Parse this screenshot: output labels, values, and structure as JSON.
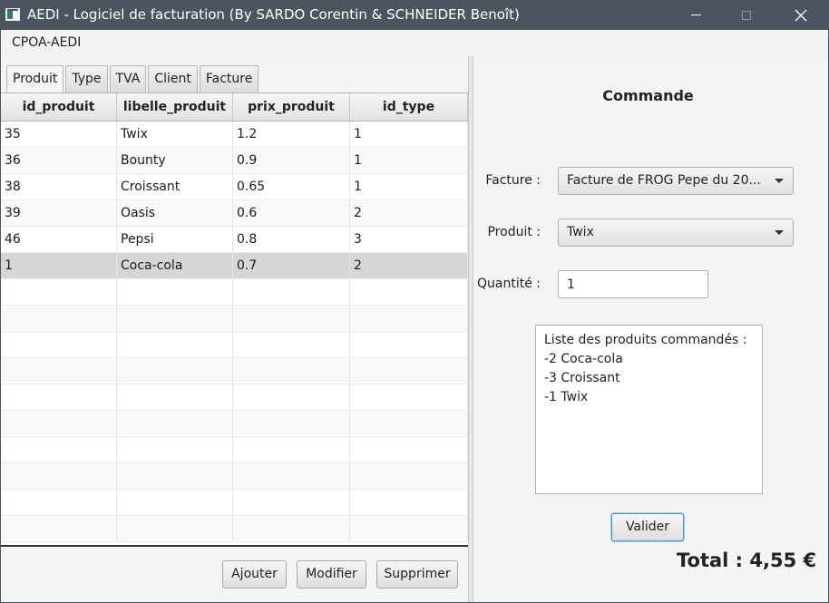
{
  "window": {
    "title": "AEDI - Logiciel de facturation (By SARDO Corentin & SCHNEIDER Benoît)"
  },
  "menu": {
    "items": [
      "CPOA-AEDI"
    ]
  },
  "tabs": [
    {
      "label": "Produit",
      "active": true
    },
    {
      "label": "Type",
      "active": false
    },
    {
      "label": "TVA",
      "active": false
    },
    {
      "label": "Client",
      "active": false
    },
    {
      "label": "Facture",
      "active": false
    }
  ],
  "table": {
    "columns": [
      "id_produit",
      "libelle_produit",
      "prix_produit",
      "id_type"
    ],
    "rows": [
      {
        "cells": [
          "35",
          "Twix",
          "1.2",
          "1"
        ],
        "selected": false
      },
      {
        "cells": [
          "36",
          "Bounty",
          "0.9",
          "1"
        ],
        "selected": false
      },
      {
        "cells": [
          "38",
          "Croissant",
          "0.65",
          "1"
        ],
        "selected": false
      },
      {
        "cells": [
          "39",
          "Oasis",
          "0.6",
          "2"
        ],
        "selected": false
      },
      {
        "cells": [
          "46",
          "Pepsi",
          "0.8",
          "3"
        ],
        "selected": false
      },
      {
        "cells": [
          "1",
          "Coca-cola",
          "0.7",
          "2"
        ],
        "selected": true
      }
    ],
    "empty_rows": 10
  },
  "left_actions": {
    "add_label": "Ajouter",
    "edit_label": "Modifier",
    "delete_label": "Supprimer"
  },
  "order_form": {
    "title": "Commande",
    "facture_label": "Facture :",
    "facture_value": "Facture de FROG Pepe du 20...",
    "produit_label": "Produit :",
    "produit_value": "Twix",
    "quantite_label": "Quantité :",
    "quantite_value": "1",
    "orders_lines": [
      "Liste des produits commandés :",
      "-2 Coca-cola",
      "-3 Croissant",
      "-1 Twix"
    ],
    "validate_label": "Valider",
    "total": "Total : 4,55 €"
  },
  "colors": {
    "titlebar": "#4b5560",
    "selected_row": "#d6d6d6",
    "focus_border": "#4a90c4"
  },
  "icons": {
    "app": "app-window-icon",
    "minimize": "minimize-icon",
    "maximize": "maximize-icon",
    "close": "close-icon",
    "dropdown": "chevron-down-icon"
  }
}
